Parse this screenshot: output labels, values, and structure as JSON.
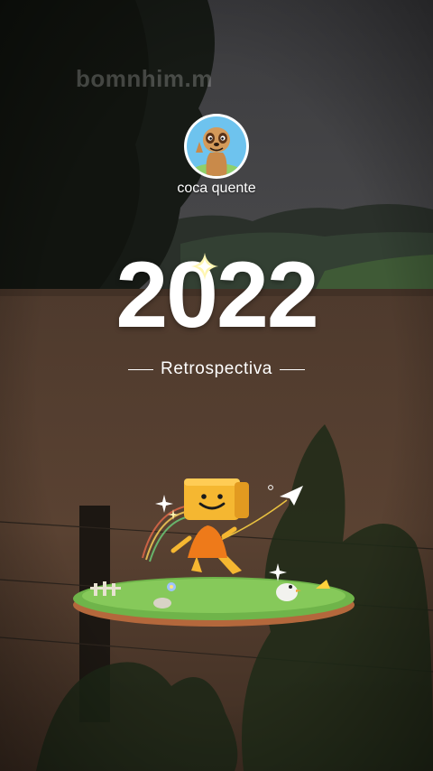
{
  "watermark": {
    "text": "bomnhim.m"
  },
  "profile": {
    "username": "coca quente",
    "avatar_icon": "meerkat-avatar-icon"
  },
  "hero": {
    "year": "2022",
    "subtitle": "Retrospectiva",
    "sparkle_icon": "sparkle-icon"
  },
  "illustration": {
    "icons": [
      "box-head-character-icon",
      "paper-plane-icon",
      "grass-island-icon",
      "bird-icon",
      "fence-icon",
      "sparkle-icon"
    ]
  },
  "colors": {
    "text": "#ffffff",
    "character_yellow": "#f5b731",
    "character_orange": "#ee7a1a",
    "grass": "#6fb44a",
    "soil": "#c27a4a",
    "water": "#5a4232"
  }
}
